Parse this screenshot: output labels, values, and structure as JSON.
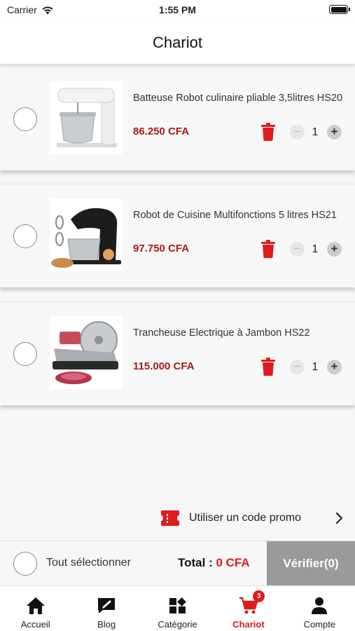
{
  "status_bar": {
    "carrier": "Carrier",
    "time": "1:55 PM"
  },
  "header": {
    "title": "Chariot"
  },
  "items": [
    {
      "title": "Batteuse Robot culinaire pliable 3,5litres HS20",
      "price": "86.250 CFA",
      "quantity": "1",
      "image_icon": "stand-mixer-white-image"
    },
    {
      "title": "Robot de Cuisine Multifonctions 5 litres HS21",
      "price": "97.750 CFA",
      "quantity": "1",
      "image_icon": "stand-mixer-black-image"
    },
    {
      "title": "Trancheuse Electrique à Jambon HS22",
      "price": "115.000 CFA",
      "quantity": "1",
      "image_icon": "meat-slicer-image"
    }
  ],
  "controls": {
    "minus": "−",
    "plus": "+",
    "trash_icon": "trash-icon"
  },
  "promo": {
    "label": "Utiliser un code promo",
    "icon": "coupon-icon"
  },
  "footer": {
    "select_all": "Tout sélectionner",
    "total_label": "Total :",
    "total_value": "0 CFA",
    "verify_label": "Vérifier(0)"
  },
  "tabbar": {
    "tabs": [
      {
        "label": "Accueil",
        "icon": "home-icon"
      },
      {
        "label": "Blog",
        "icon": "blog-icon"
      },
      {
        "label": "Catégorie",
        "icon": "category-icon"
      },
      {
        "label": "Chariot",
        "icon": "cart-icon",
        "badge": "3"
      },
      {
        "label": "Compte",
        "icon": "user-icon"
      }
    ]
  },
  "colors": {
    "accent": "#e01b1b",
    "price": "#a81a1a",
    "verify_bg": "#9a9a9a"
  }
}
